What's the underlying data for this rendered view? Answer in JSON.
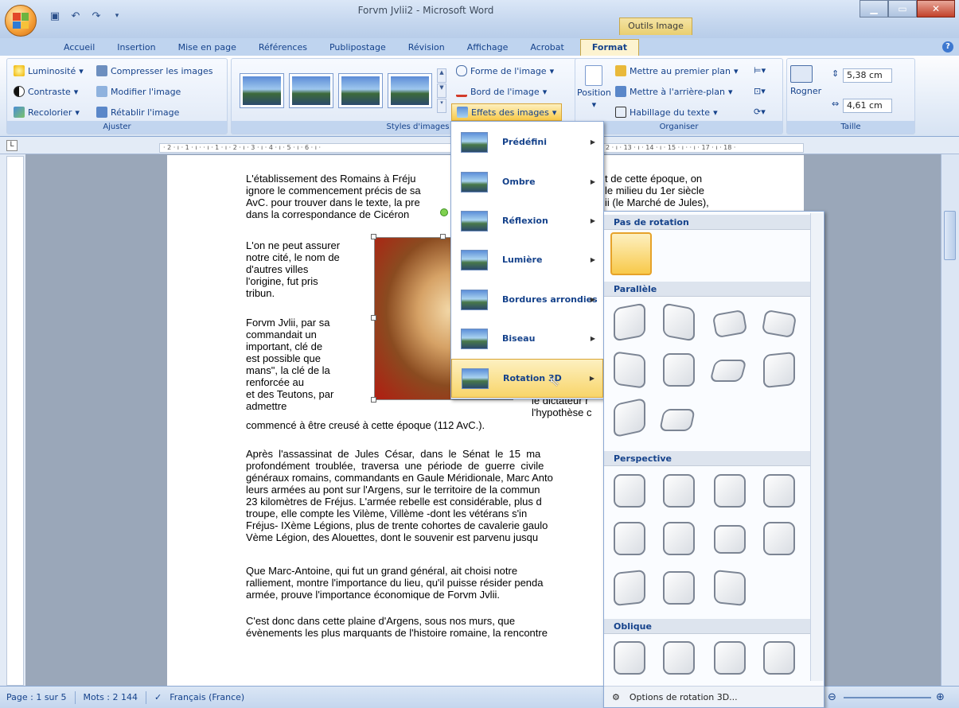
{
  "window": {
    "title": "Forvm Jvlii2 - Microsoft Word",
    "context_tab_group": "Outils Image"
  },
  "tabs": [
    "Accueil",
    "Insertion",
    "Mise en page",
    "Références",
    "Publipostage",
    "Révision",
    "Affichage",
    "Acrobat",
    "Format"
  ],
  "active_tab": "Format",
  "ribbon": {
    "ajuster": {
      "label": "Ajuster",
      "luminosite": "Luminosité",
      "contraste": "Contraste",
      "recolorier": "Recolorier",
      "compresser": "Compresser les images",
      "modifier": "Modifier l'image",
      "retablir": "Rétablir l'image"
    },
    "styles": {
      "label": "Styles d'images",
      "forme": "Forme de l'image",
      "bord": "Bord de l'image",
      "effets": "Effets des images"
    },
    "organiser": {
      "label": "Organiser",
      "position": "Position",
      "premier_plan": "Mettre au premier plan",
      "arriere_plan": "Mettre à l'arrière-plan",
      "habillage": "Habillage du texte"
    },
    "taille": {
      "label": "Taille",
      "rogner": "Rogner",
      "hauteur": "5,38 cm",
      "largeur": "4,61 cm"
    }
  },
  "ruler_h_text": "· 2 · ı · 1 · ı ·   · ı · 1 · ı · 2 · ı · 3 · ı · 4 · ı · 5 · ı · 6 · ı ·",
  "ruler_h_right": "2 · ı · 13 · ı · 14 · ı · 15 · ı ·   · ı · 17 · ı · 18 ·",
  "ruler_corner": "L",
  "document": {
    "p1": "L'établissement des Romains à Fréju\nignore le commencement précis de sa\nAvC. pour trouver dans le texte, la pre\ndans la correspondance de Cicéron",
    "p1_right": "t de cette époque, on\nle milieu du 1er siècle\nii (le Marché de Jules),",
    "p2": "L'on ne peut assurer\nnotre cité, le nom de\nd'autres villes\nl'origine, fut pris\ntribun.",
    "p3": "Forvm Jvlii, par sa\ncommandait un\nimportant, clé de\nest possible que\nmans\", la clé de la\nrenforcée au\net des Teutons, par\nadmettre",
    "p3_right": "le dictateur r\nl'hypothèse c",
    "p3_end": "commencé à être creusé à cette époque (112 AvC.).",
    "p4": "Après  l'assassinat  de  Jules  César,  dans  le  Sénat  le  15  ma\nprofondément  troublée,  traversa  une  période  de  guerre  civile\ngénéraux romains, commandants en Gaule Méridionale, Marc Anto\nleurs armées au pont sur l'Argens, sur le territoire de la commun\n23 kilomètres de Fréjus. L'armée rebelle est considérable, plus d\ntroupe, elle compte les Vilème, Villème -dont les vétérans s'in\nFréjus- IXème Légions, plus de trente cohortes de cavalerie gaulo\nVème Légion, des Alouettes, dont le souvenir est parvenu jusqu",
    "p5": "Que Marc-Antoine, qui fut un grand général, ait choisi notre\nralliement, montre l'importance du lieu, qu'il puisse résider penda\narmée, prouve l'importance économique de Forvm Jvlii.",
    "p6": "C'est donc dans cette plaine d'Argens, sous nos murs, que\névènements les plus marquants de l'histoire romaine, la rencontre"
  },
  "effects_menu": [
    {
      "label": "Prédéfini"
    },
    {
      "label": "Ombre"
    },
    {
      "label": "Réflexion"
    },
    {
      "label": "Lumière"
    },
    {
      "label": "Bordures arrondies"
    },
    {
      "label": "Biseau"
    },
    {
      "label": "Rotation 3D"
    }
  ],
  "rotation_submenu": {
    "sections": [
      "Pas de rotation",
      "Parallèle",
      "Perspective",
      "Oblique"
    ],
    "footer": "Options de rotation 3D..."
  },
  "statusbar": {
    "page": "Page : 1 sur 5",
    "mots": "Mots : 2 144",
    "langue": "Français (France)"
  },
  "colors": {
    "ribbon_blue": "#15428b",
    "highlight": "#f8d56a",
    "tab_active": "#fdf3d0"
  }
}
